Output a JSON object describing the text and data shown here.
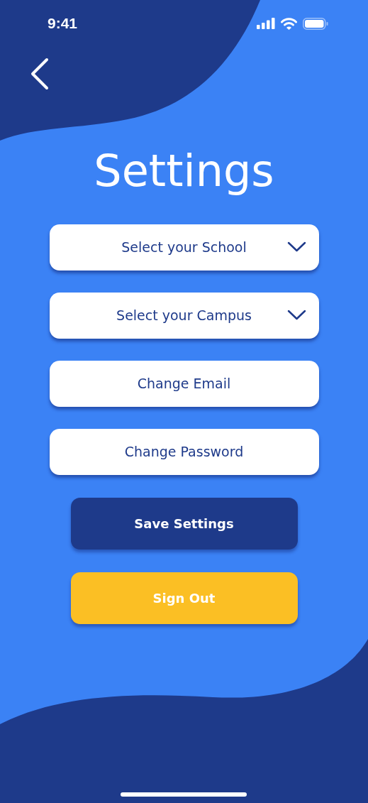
{
  "status_bar": {
    "time": "9:41"
  },
  "title": "Settings",
  "options": [
    {
      "kind": "dropdown",
      "label": "Select your School"
    },
    {
      "kind": "dropdown",
      "label": "Select your Campus"
    },
    {
      "kind": "button",
      "label": "Change Email"
    },
    {
      "kind": "button",
      "label": "Change Password"
    }
  ],
  "actions": [
    {
      "kind": "primary",
      "label": "Save Settings"
    },
    {
      "kind": "warning",
      "label": "Sign Out"
    }
  ]
}
